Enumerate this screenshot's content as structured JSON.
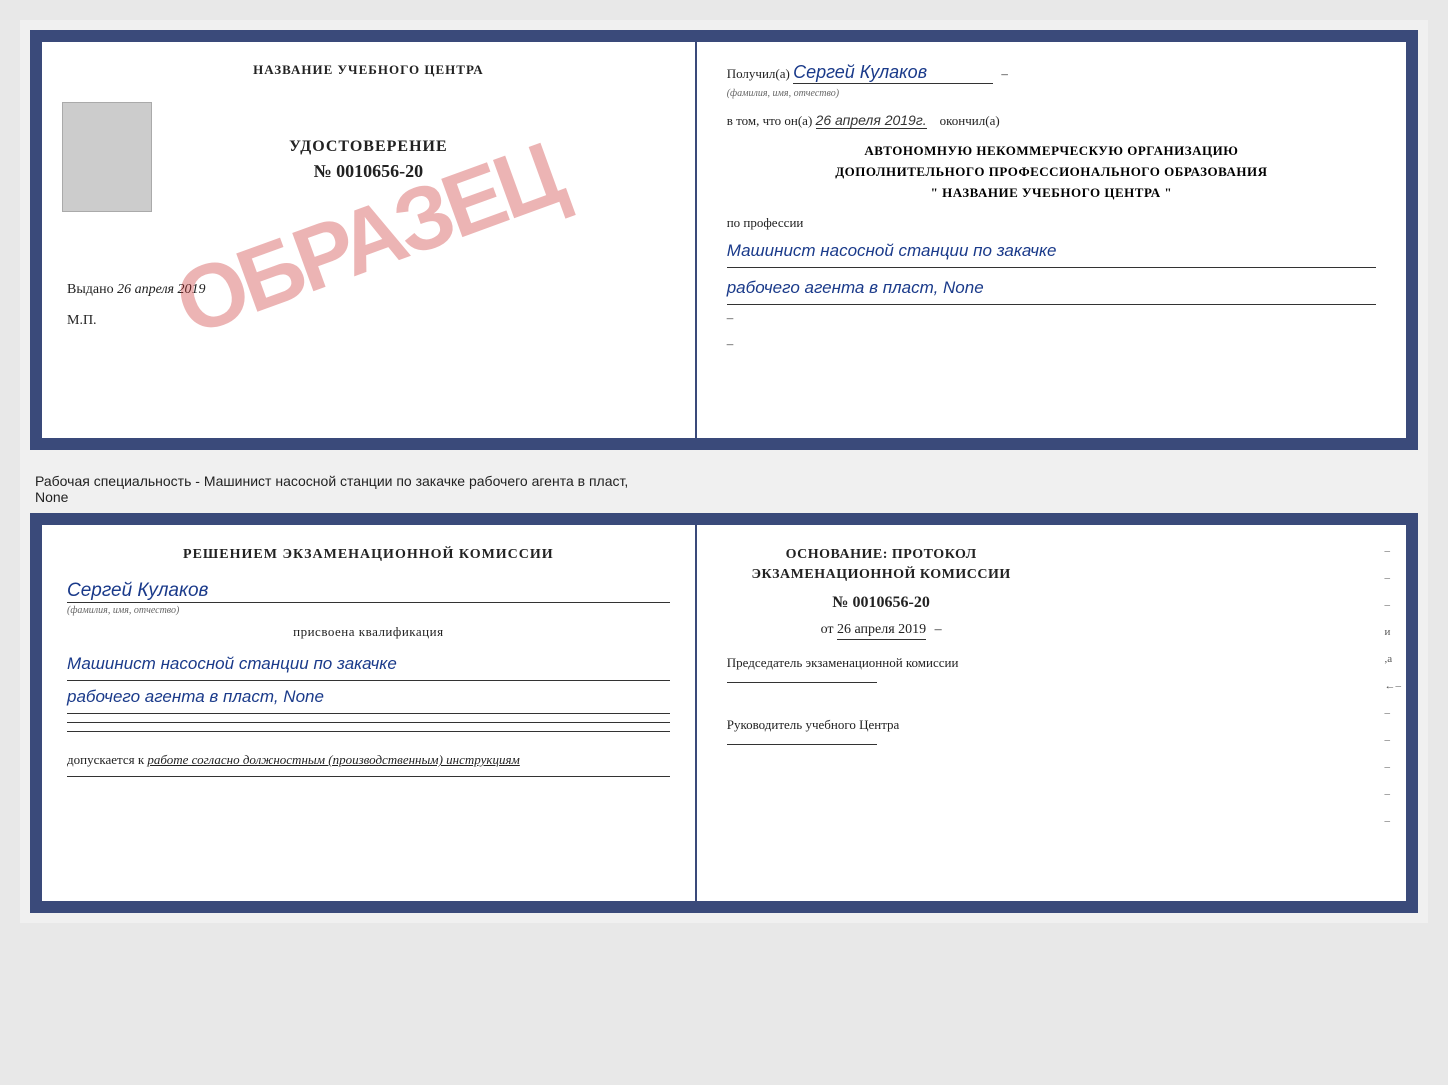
{
  "page": {
    "bg_color": "#e8e8e8"
  },
  "top_doc": {
    "left": {
      "center_title": "НАЗВАНИЕ УЧЕБНОГО ЦЕНТРА",
      "obrazec_stamp": "ОБРАЗЕЦ",
      "udostoverenie": "УДОСТОВЕРЕНИЕ",
      "number": "№ 0010656-20",
      "vydano_label": "Выдано",
      "vydano_date": "26 апреля 2019",
      "mp_label": "М.П."
    },
    "right": {
      "poluchil_label": "Получил(а)",
      "person_name": "Сергей Кулаков",
      "fio_hint": "(фамилия, имя, отчество)",
      "v_tom_label": "в том, что он(а)",
      "date": "26 апреля 2019г.",
      "okonchil_label": "окончил(а)",
      "org_line1": "АВТОНОМНУЮ НЕКОММЕРЧЕСКУЮ ОРГАНИЗАЦИЮ",
      "org_line2": "ДОПОЛНИТЕЛЬНОГО ПРОФЕССИОНАЛЬНОГО ОБРАЗОВАНИЯ",
      "org_line3": "\" НАЗВАНИЕ УЧЕБНОГО ЦЕНТРА \"",
      "po_professii_label": "по профессии",
      "profession_line1": "Машинист насосной станции по закачке",
      "profession_line2": "рабочего агента в пласт, None"
    }
  },
  "description": {
    "text_line1": "Рабочая специальность - Машинист насосной станции по закачке рабочего агента в пласт,",
    "text_line2": "None"
  },
  "bottom_doc": {
    "left": {
      "commission_title": "Решением экзаменационной комиссии",
      "person_name": "Сергей Кулаков",
      "fio_hint": "(фамилия, имя, отчество)",
      "prisvoena_label": "присвоена квалификация",
      "qualification_line1": "Машинист насосной станции по закачке",
      "qualification_line2": "рабочего агента в пласт, None",
      "dopuskaetsya_label": "допускается к",
      "dopuskaetsya_text": "работе согласно должностным (производственным) инструкциям"
    },
    "right": {
      "osnovanie_title": "Основание: протокол экзаменационной комиссии",
      "number": "№ 0010656-20",
      "ot_label": "от",
      "date": "26 апреля 2019",
      "predsedatel_label": "Председатель экзаменационной комиссии",
      "rukovoditel_label": "Руководитель учебного Центра"
    }
  },
  "margin_dashes": [
    "-",
    "-",
    "-",
    "и",
    "а",
    "←",
    "-",
    "-",
    "-",
    "-",
    "-"
  ]
}
